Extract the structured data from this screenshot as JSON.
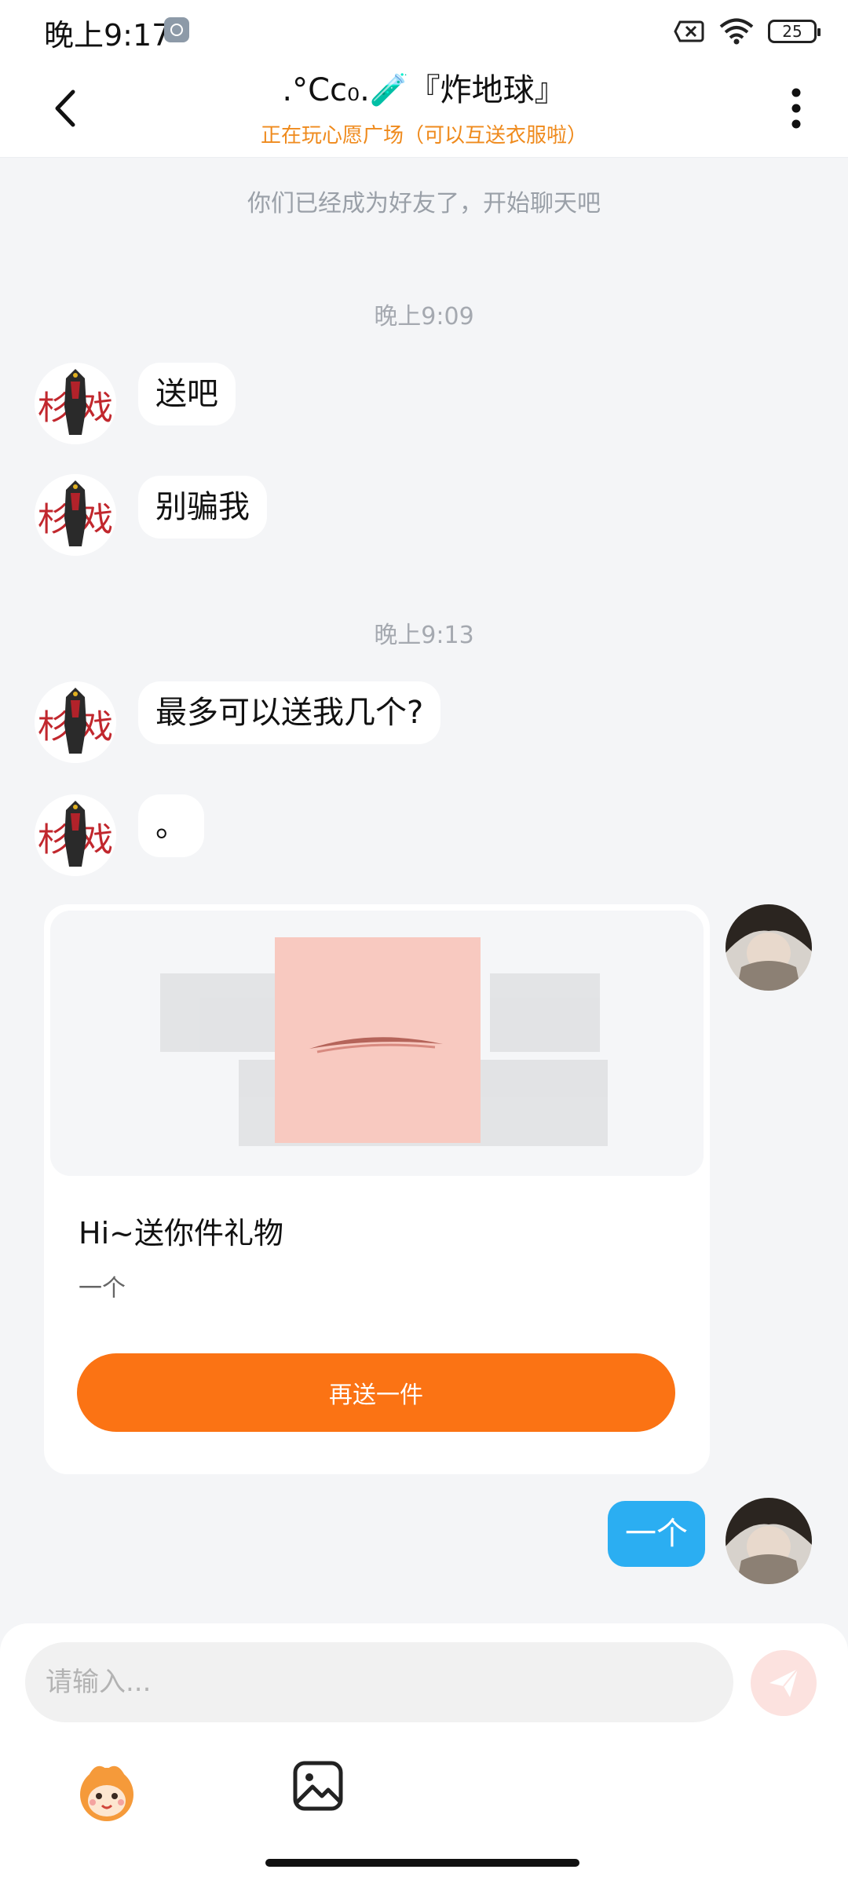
{
  "status_bar": {
    "time": "晚上9:17",
    "battery": "25"
  },
  "header": {
    "title": ".°Cc₀.🧪『炸地球』",
    "subtitle": "正在玩心愿广场（可以互送衣服啦）"
  },
  "chat": {
    "friend_notice": "你们已经成为好友了，开始聊天吧",
    "time_1": "晚上9:09",
    "time_2": "晚上9:13",
    "messages": [
      {
        "from": "other",
        "text": "送吧"
      },
      {
        "from": "other",
        "text": "别骗我"
      },
      {
        "from": "other",
        "text": "最多可以送我几个?"
      },
      {
        "from": "other",
        "text": "。"
      },
      {
        "from": "me",
        "text": "一个"
      }
    ],
    "gift_card": {
      "title": "Hi~送你件礼物",
      "desc": "一个",
      "button_label": "再送一件"
    }
  },
  "input": {
    "placeholder": "请输入..."
  },
  "colors": {
    "accent_orange": "#fb7314",
    "subtitle_orange": "#ef8a1c",
    "outgoing_bubble": "#2baef2",
    "background": "#f4f5f7"
  }
}
